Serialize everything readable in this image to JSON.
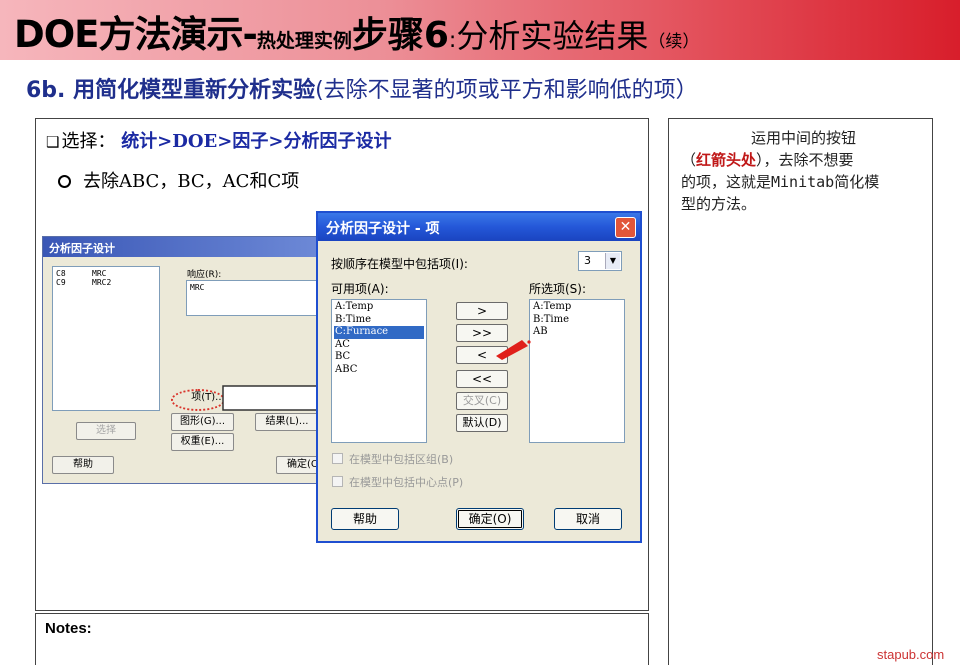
{
  "header": {
    "title_main": "DOE方法演示-",
    "title_small": "热处理实例",
    "title_step": "步骤6",
    "title_colon": ":",
    "title_result": "分析实验结果",
    "title_cont": "（续）"
  },
  "subtitle": {
    "bold": "6b. 用简化模型重新分析实验",
    "plain": "(去除不显著的项或平方和影响低的项）"
  },
  "main": {
    "select_prefix": "选择：",
    "select_path": "统计>DOE>因子>分析因子设计",
    "option_text": "去除ABC，BC，AC和C项"
  },
  "bg_dialog": {
    "title": "分析因子设计",
    "columns": [
      {
        "id": "C8",
        "name": "MRC"
      },
      {
        "id": "C9",
        "name": "MRC2"
      }
    ],
    "response_label": "响应(R):",
    "response_value": "MRC",
    "btn_terms": "项(T)...",
    "btn_graph": "图形(G)...",
    "btn_results": "结果(L)...",
    "btn_weights": "权重(E)...",
    "btn_select": "选择",
    "btn_help": "帮助",
    "btn_ok": "确定(O)"
  },
  "fg_dialog": {
    "title": "分析因子设计 - 项",
    "close": "✕",
    "order_label": "按顺序在模型中包括项(I):",
    "order_value": "3",
    "available_label": "可用项(A):",
    "selected_label": "所选项(S):",
    "available_items": [
      "A:Temp",
      "B:Time",
      "C:Furnace",
      "AC",
      "BC",
      "ABC"
    ],
    "selected_available_index": 2,
    "selected_items": [
      "A:Temp",
      "B:Time",
      "AB"
    ],
    "btn_add": ">",
    "btn_add_all": ">>",
    "btn_remove": "<",
    "btn_remove_all": "<<",
    "btn_cross": "交叉(C)",
    "btn_default": "默认(D)",
    "chk_blocks": "在模型中包括区组(B)",
    "chk_center": "在模型中包括中心点(P)",
    "btn_help": "帮助",
    "btn_ok": "确定(O)",
    "btn_cancel": "取消"
  },
  "notes": {
    "label": "Notes:"
  },
  "comment": {
    "line1": "运用中间的按钮",
    "line2_open": "（",
    "line2_red": "红箭头处",
    "line2_rest": "），去除不想要",
    "line3": "的项，这就是Minitab简化模",
    "line4": "型的方法。"
  },
  "watermark": "stapub.com",
  "colors": {
    "banner_start": "#f6b6bc",
    "banner_end": "#d81e2b",
    "subtitle_blue": "#1f2f8c",
    "select_blue": "#1b2aa3",
    "xp_title_blue": "#2457d8",
    "selection_blue": "#316ac5",
    "red_arrow": "#e0201a"
  }
}
